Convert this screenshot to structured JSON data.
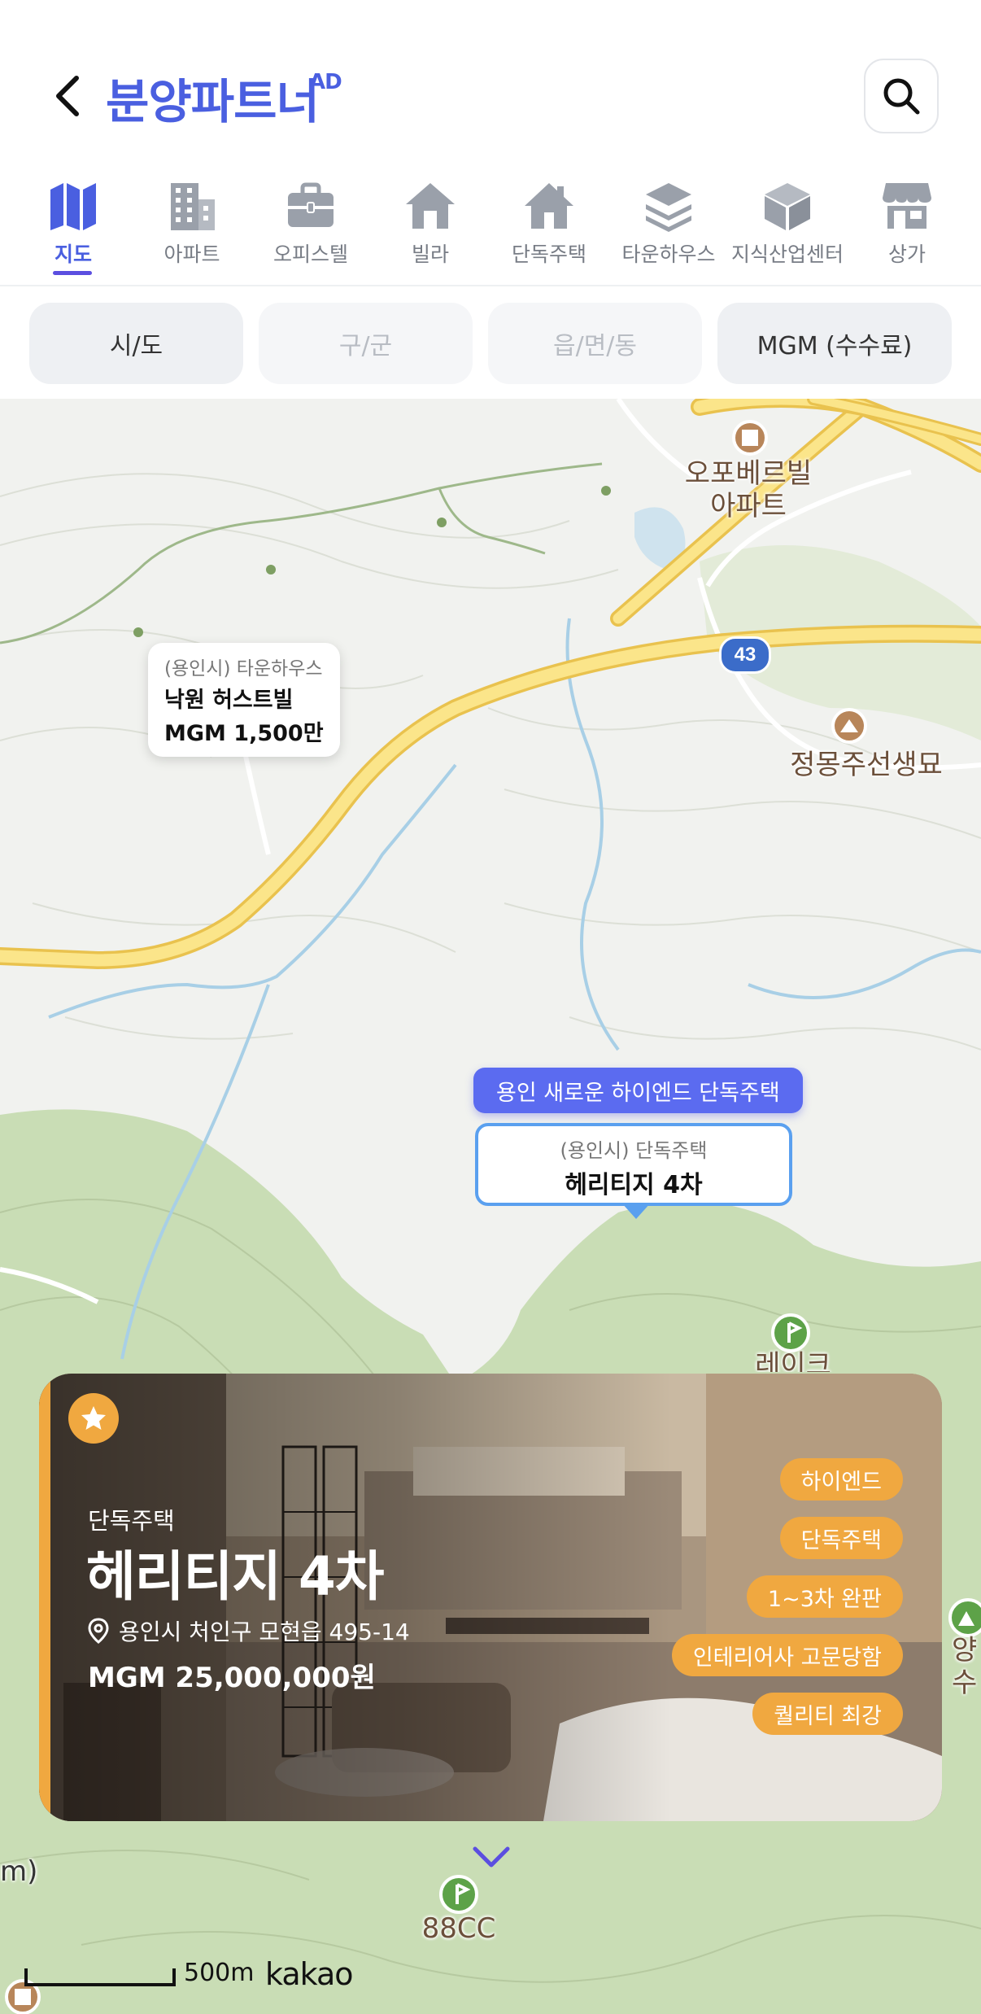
{
  "header": {
    "brand": "분양파트너",
    "ad_badge": "AD"
  },
  "tabs": [
    {
      "label": "지도",
      "icon": "map-icon",
      "active": true
    },
    {
      "label": "아파트",
      "icon": "apartment-icon"
    },
    {
      "label": "오피스텔",
      "icon": "briefcase-icon"
    },
    {
      "label": "빌라",
      "icon": "house-icon"
    },
    {
      "label": "단독주택",
      "icon": "house-solid-icon"
    },
    {
      "label": "타운하우스",
      "icon": "layers-icon"
    },
    {
      "label": "지식산업센터",
      "icon": "box-icon"
    },
    {
      "label": "상가",
      "icon": "store-icon"
    }
  ],
  "filters": {
    "sido": "시/도",
    "gugun": "구/군",
    "eupmyeondong": "읍/면/동",
    "mgm": "MGM (수수료)"
  },
  "map": {
    "poi_opo": "오포베르빌\n아파트",
    "poi_jeongmong": "정몽주선생묘",
    "poi_lake": "레이크",
    "poi_88cc": "88CC",
    "poi_right_edge": "양수",
    "poi_left_edge": "m)",
    "route_number": "43",
    "card_nakwon": {
      "sub": "(용인시) 타운하우스",
      "title": "낙원 허스트빌",
      "price": "MGM 1,500만"
    },
    "promo_label": "용인 새로운 하이엔드 단독주택",
    "card_selected": {
      "sub": "(용인시) 단독주택",
      "title": "헤리티지 4차"
    },
    "scale_text": "500m",
    "provider": "kakao"
  },
  "listing": {
    "type": "단독주택",
    "title": "헤리티지 4차",
    "address": "용인시 처인구 모현읍 495-14",
    "price": "MGM 25,000,000원",
    "tags": [
      "하이엔드",
      "단독주택",
      "1~3차 완판",
      "인테리어사 고문당함",
      "퀄리티 최강"
    ]
  },
  "colors": {
    "brand": "#4a5fe0",
    "accent_orange": "#f0a840",
    "selected_border": "#5aa0ef",
    "promo": "#5b6bf0"
  }
}
